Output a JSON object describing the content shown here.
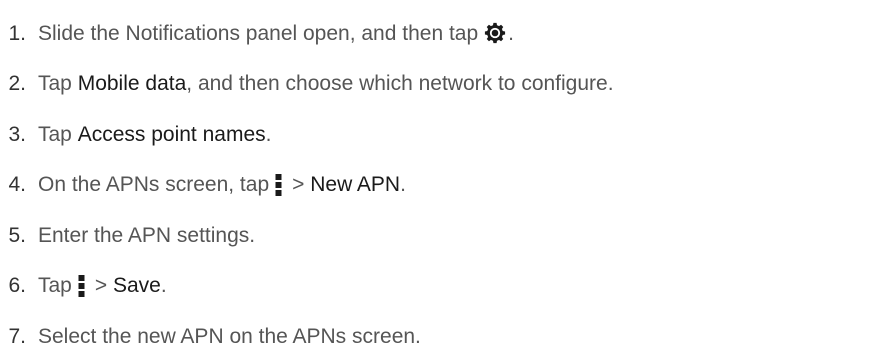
{
  "steps": [
    {
      "number": "1.",
      "before": "Slide the Notifications panel open, and then tap",
      "icon": "settings-gear-icon",
      "after": "."
    },
    {
      "number": "2.",
      "before": "Tap ",
      "bold": "Mobile data",
      "after": ", and then choose which network to configure."
    },
    {
      "number": "3.",
      "before": "Tap ",
      "bold": "Access point names",
      "after": "."
    },
    {
      "number": "4.",
      "before": "On the APNs screen, tap",
      "icon": "overflow-menu-icon",
      "middle": "> ",
      "bold": "New APN",
      "after": "."
    },
    {
      "number": "5.",
      "before": "Enter the APN settings."
    },
    {
      "number": "6.",
      "before": "Tap",
      "icon": "overflow-menu-icon",
      "middle": "> ",
      "bold": "Save",
      "after": "."
    },
    {
      "number": "7.",
      "before": "Select the new APN on the APNs screen."
    }
  ]
}
